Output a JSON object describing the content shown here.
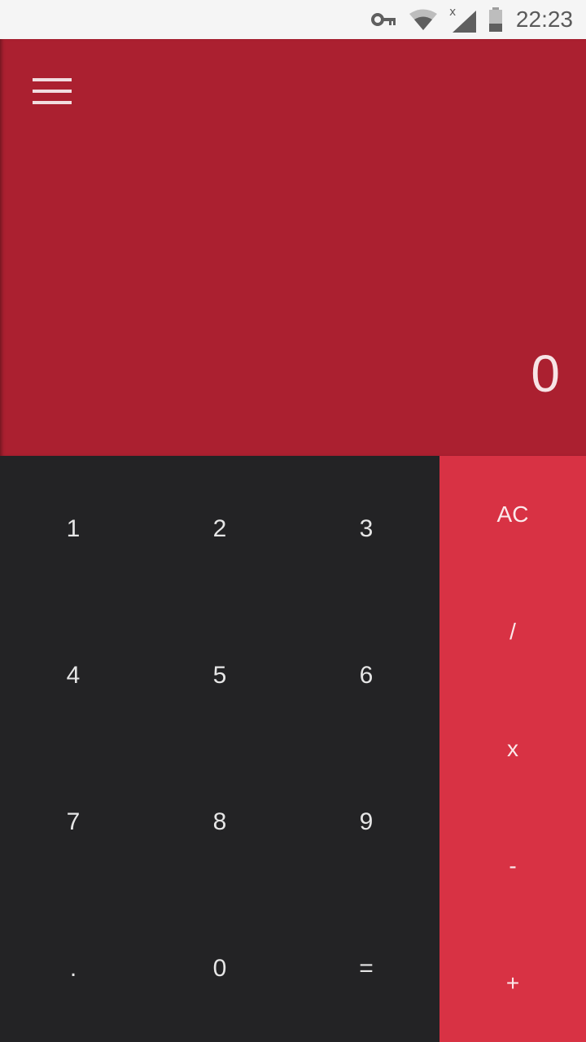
{
  "status_bar": {
    "time": "22:23",
    "icons": [
      "vpn-key-icon",
      "wifi-icon",
      "cell-signal-icon",
      "battery-icon"
    ]
  },
  "display": {
    "value": "0",
    "menu_icon": "hamburger-menu-icon"
  },
  "keypad": {
    "k1": "1",
    "k2": "2",
    "k3": "3",
    "k4": "4",
    "k5": "5",
    "k6": "6",
    "k7": "7",
    "k8": "8",
    "k9": "9",
    "kdot": ".",
    "k0": "0",
    "keq": "="
  },
  "operators": {
    "clear": "AC",
    "divide": "/",
    "multiply": "x",
    "subtract": "-",
    "add": "+"
  },
  "colors": {
    "display_bg": "#ab2030",
    "keypad_bg": "#232325",
    "operator_bg": "#d83244",
    "status_bar_bg": "#f5f5f5"
  }
}
